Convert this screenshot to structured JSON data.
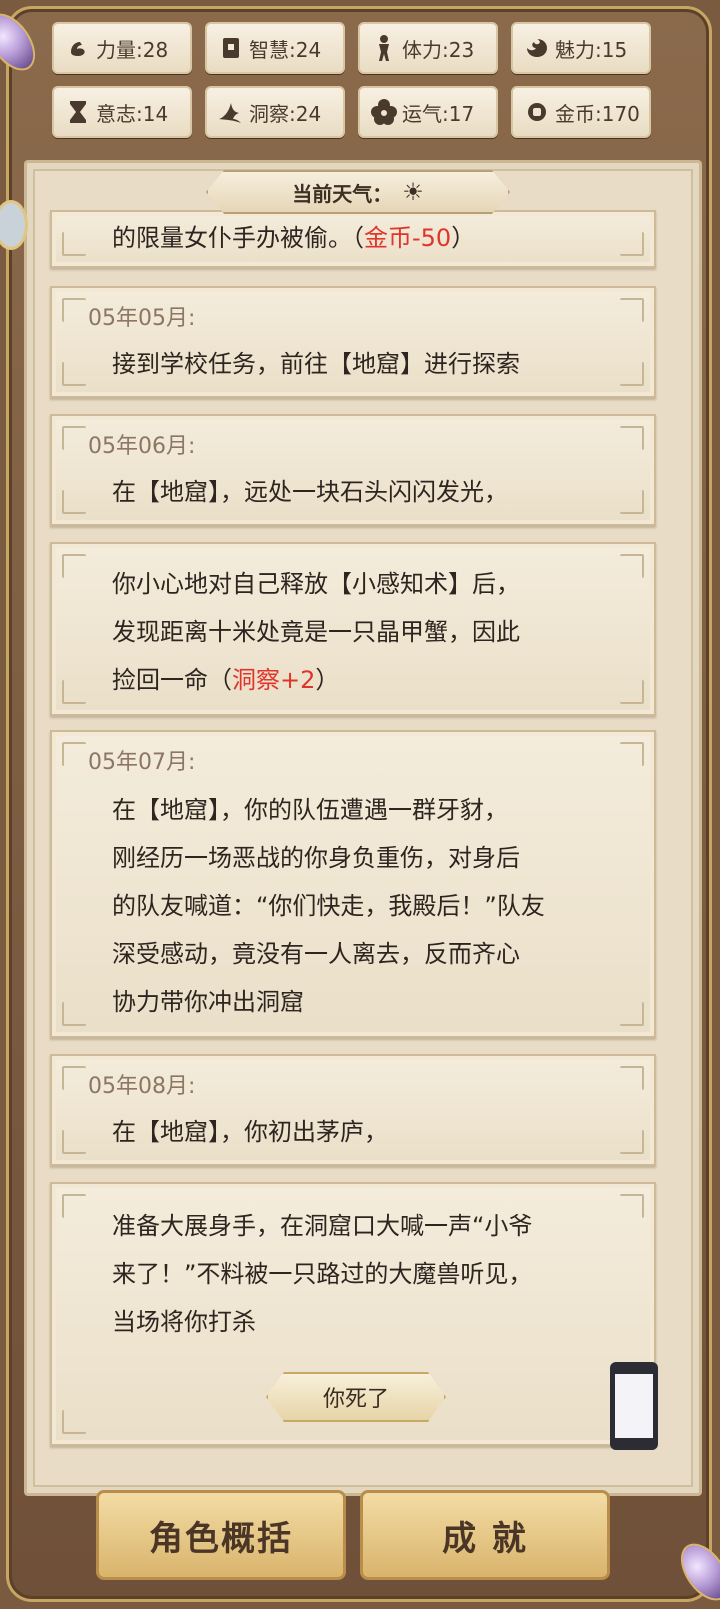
{
  "stats": [
    {
      "label": "力量:28",
      "icon": "arm-icon"
    },
    {
      "label": "智慧:24",
      "icon": "book-icon"
    },
    {
      "label": "体力:23",
      "icon": "person-icon"
    },
    {
      "label": "魅力:15",
      "icon": "charm-icon"
    },
    {
      "label": "意志:14",
      "icon": "hourglass-icon"
    },
    {
      "label": "洞察:24",
      "icon": "claw-icon"
    },
    {
      "label": "运气:17",
      "icon": "clover-icon"
    },
    {
      "label": "金币:170",
      "icon": "coin-icon"
    }
  ],
  "weather": {
    "label": "当前天气：",
    "icon": "sun-icon"
  },
  "log": {
    "c1_text_a": "的限量女仆手办被偷。（",
    "c1_red": "金币-50",
    "c1_text_b": "）",
    "c2_date": "05年05月:",
    "c2_text": "接到学校任务，前往【地窟】进行探索",
    "c3_date": "05年06月:",
    "c3_text": "在【地窟】，远处一块石头闪闪发光，",
    "c4_line1": "你小心地对自己释放【小感知术】后，",
    "c4_line2": "发现距离十米处竟是一只晶甲蟹，因此",
    "c4_line3a": "捡回一命（",
    "c4_red": "洞察+2",
    "c4_line3b": "）",
    "c5_date": "05年07月:",
    "c5_lines": [
      "在【地窟】，你的队伍遭遇一群牙豺，",
      "刚经历一场恶战的你身负重伤，对身后",
      "的队友喊道：“你们快走，我殿后！”队友",
      "深受感动，竟没有一人离去，反而齐心",
      "协力带你冲出洞窟"
    ],
    "c6_date": "05年08月:",
    "c6_text": "在【地窟】，你初出茅庐，",
    "c7_lines": [
      "准备大展身手，在洞窟口大喊一声“小爷",
      "来了！”不料被一只路过的大魔兽听见，",
      "当场将你打杀"
    ]
  },
  "death_button": "你死了",
  "bottom": {
    "summary": "角色概括",
    "achievements": "成 就"
  }
}
